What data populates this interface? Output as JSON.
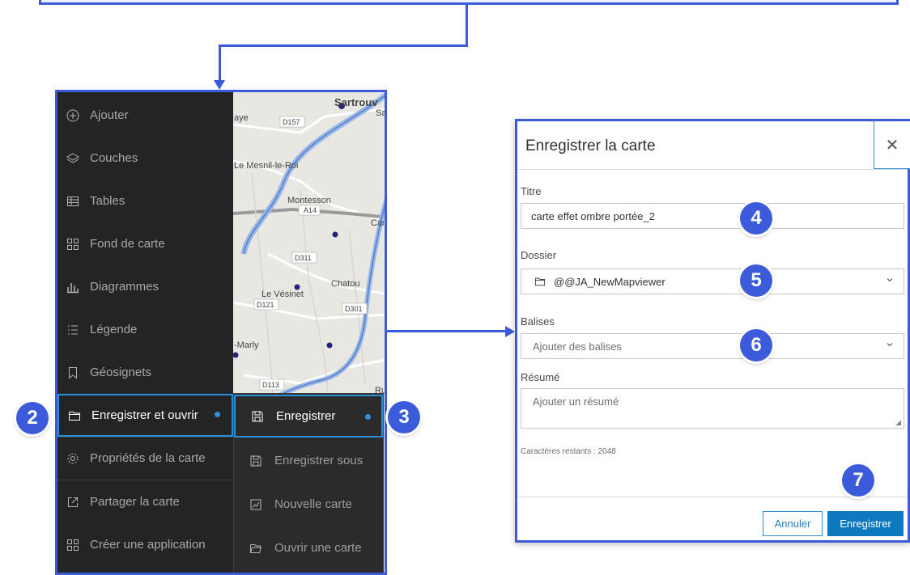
{
  "sidebar": {
    "items": [
      {
        "label": "Ajouter",
        "icon": "plus-circle-icon"
      },
      {
        "label": "Couches",
        "icon": "layers-icon"
      },
      {
        "label": "Tables",
        "icon": "table-icon"
      },
      {
        "label": "Fond de carte",
        "icon": "basemap-icon"
      },
      {
        "label": "Diagrammes",
        "icon": "chart-icon"
      },
      {
        "label": "Légende",
        "icon": "legend-icon"
      },
      {
        "label": "Géosignets",
        "icon": "bookmark-icon"
      },
      {
        "label": "Enregistrer et ouvrir",
        "icon": "folder-icon"
      },
      {
        "label": "Propriétés de la carte",
        "icon": "gear-icon"
      },
      {
        "label": "Partager la carte",
        "icon": "share-icon"
      },
      {
        "label": "Créer une application",
        "icon": "apps-icon"
      }
    ]
  },
  "submenu": {
    "items": [
      {
        "label": "Enregistrer",
        "icon": "save-icon"
      },
      {
        "label": "Enregistrer sous",
        "icon": "save-as-icon"
      },
      {
        "label": "Nouvelle carte",
        "icon": "new-map-icon"
      },
      {
        "label": "Ouvrir une carte",
        "icon": "open-folder-icon"
      }
    ]
  },
  "map": {
    "labels": [
      "Sartrouv",
      "Sa",
      "aye",
      "D157",
      "Le Mesnil-le-Roi",
      "Montesson",
      "A14",
      "Car",
      "D311",
      "Chatou",
      "Le Vésinet",
      "D121",
      "D301",
      "-Marly",
      "D113",
      "Ru"
    ]
  },
  "dialog": {
    "title": "Enregistrer la carte",
    "close": "✕",
    "title_label": "Titre",
    "title_value": "carte effet ombre portée_2",
    "folder_label": "Dossier",
    "folder_value": "@@JA_NewMapviewer",
    "tags_label": "Balises",
    "tags_placeholder": "Ajouter des balises",
    "summary_label": "Résumé",
    "summary_placeholder": "Ajouter un résumé",
    "chars_remaining": "Caractères restants : 2048",
    "cancel": "Annuler",
    "save": "Enregistrer"
  },
  "badges": [
    "2",
    "3",
    "4",
    "5",
    "6",
    "7"
  ],
  "colors": {
    "accent": "#3b5bdb",
    "active": "#2a8fd6",
    "save_button": "#0f79c0",
    "sidebar_bg": "#242424"
  }
}
